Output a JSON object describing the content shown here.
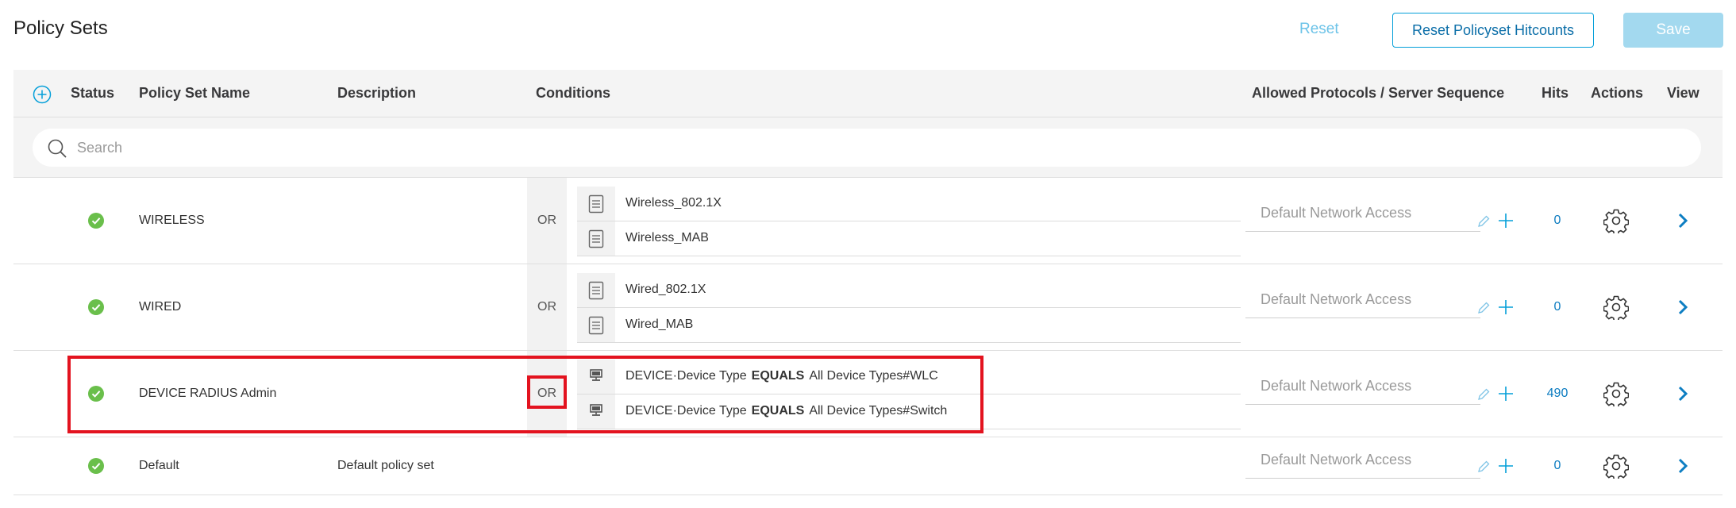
{
  "page": {
    "title": "Policy Sets"
  },
  "toolbar": {
    "reset_label": "Reset",
    "reset_hitcounts_label": "Reset Policyset Hitcounts",
    "save_label": "Save"
  },
  "table": {
    "headers": {
      "status": "Status",
      "name": "Policy Set Name",
      "description": "Description",
      "conditions": "Conditions",
      "protocols": "Allowed Protocols / Server Sequence",
      "hits": "Hits",
      "actions": "Actions",
      "view": "View"
    },
    "search_placeholder": "Search",
    "rows": [
      {
        "name": "WIRELESS",
        "description": "",
        "operator": "OR",
        "conditions": [
          {
            "icon": "document-icon",
            "text": "Wireless_802.1X"
          },
          {
            "icon": "document-icon",
            "text": "Wireless_MAB"
          }
        ],
        "protocol": "Default Network Access",
        "hits": "0"
      },
      {
        "name": "WIRED",
        "description": "",
        "operator": "OR",
        "conditions": [
          {
            "icon": "document-icon",
            "text": "Wired_802.1X"
          },
          {
            "icon": "document-icon",
            "text": "Wired_MAB"
          }
        ],
        "protocol": "Default Network Access",
        "hits": "0"
      },
      {
        "name": "DEVICE RADIUS Admin",
        "description": "",
        "operator": "OR",
        "conditions": [
          {
            "icon": "monitor-icon",
            "attribute": "DEVICE·Device Type",
            "op": "EQUALS",
            "value": "All Device Types#WLC"
          },
          {
            "icon": "monitor-icon",
            "attribute": "DEVICE·Device Type",
            "op": "EQUALS",
            "value": "All Device Types#Switch"
          }
        ],
        "protocol": "Default Network Access",
        "hits": "490"
      },
      {
        "name": "Default",
        "description": "Default policy set",
        "protocol": "Default Network Access",
        "hits": "0"
      }
    ]
  },
  "colors": {
    "accent": "#049fd9",
    "status_ok": "#6abf4b",
    "highlight": "#e3131f",
    "header_bg": "#f4f4f4"
  }
}
